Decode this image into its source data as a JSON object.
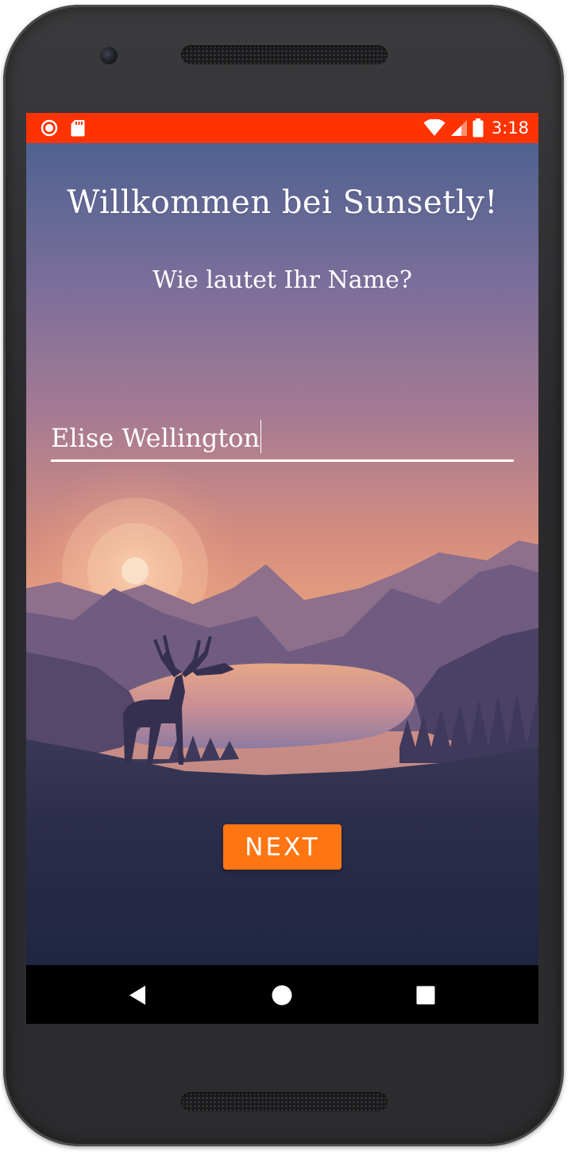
{
  "status_bar": {
    "time": "3:18",
    "left_icons": [
      "record-icon",
      "sd-card-icon"
    ],
    "right_icons": [
      "wifi-icon",
      "cell-signal-icon",
      "battery-icon"
    ],
    "color": "#ff3300"
  },
  "welcome": {
    "title": "Willkommen bei Sunsetly!",
    "question": "Wie lautet Ihr Name?"
  },
  "name_input": {
    "value": "Elise Wellington"
  },
  "actions": {
    "next_label": "NEXT",
    "next_color": "#ff7512"
  },
  "nav_bar": {
    "icons": [
      "back-icon",
      "home-icon",
      "recents-icon"
    ]
  },
  "background": {
    "scene": "sunset-landscape",
    "sky_top": "#4f6291",
    "sky_bottom": "#e39a77"
  }
}
